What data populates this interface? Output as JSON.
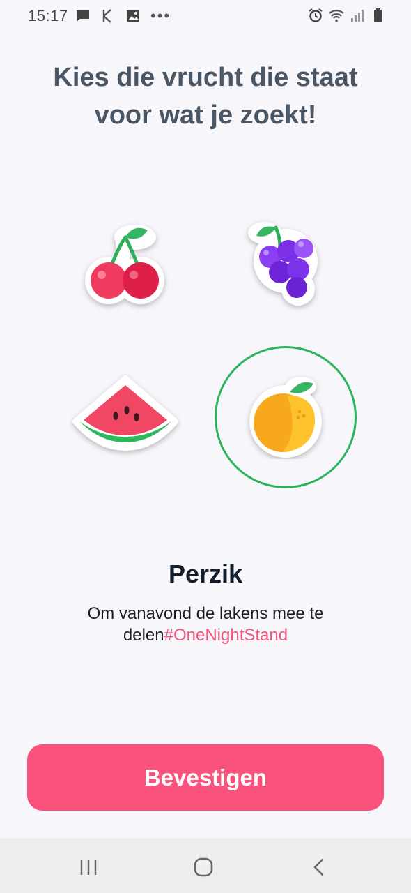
{
  "status_bar": {
    "time": "15:17",
    "left_icons": [
      "message-icon",
      "k-app-icon",
      "image-icon",
      "more-icon"
    ],
    "right_icons": [
      "alarm-icon",
      "wifi-icon",
      "signal-icon",
      "battery-icon"
    ]
  },
  "header": {
    "title": "Kies die vrucht die staat voor wat je zoekt!"
  },
  "fruits": [
    {
      "id": "cherry",
      "icon": "cherry-icon",
      "selected": false
    },
    {
      "id": "grape",
      "icon": "grape-icon",
      "selected": false
    },
    {
      "id": "watermelon",
      "icon": "watermelon-icon",
      "selected": false
    },
    {
      "id": "peach",
      "icon": "peach-icon",
      "selected": true
    }
  ],
  "selection": {
    "name": "Perzik",
    "description": "Om vanavond de lakens mee te delen",
    "hashtag": "#OneNightStand"
  },
  "confirm_button": {
    "label": "Bevestigen"
  },
  "colors": {
    "accent": "#f9527c",
    "selection_ring": "#2cb45a",
    "title_text": "#4a5663",
    "background": "#f7f7fb"
  },
  "nav_bar": {
    "buttons": [
      "recent-apps-icon",
      "home-icon",
      "back-icon"
    ]
  }
}
